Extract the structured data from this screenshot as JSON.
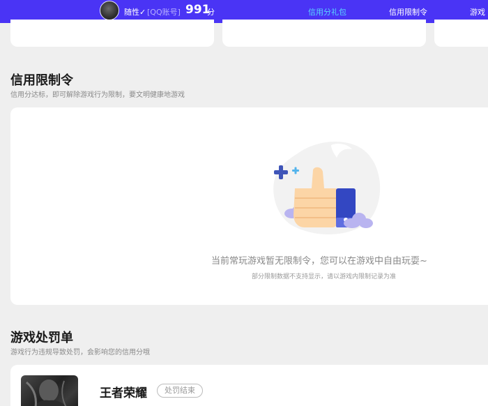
{
  "header": {
    "nickname": "随性✓",
    "account_type": "[QQ账号]",
    "score_value": "991",
    "score_unit": "分",
    "tabs": [
      {
        "label": "信用分礼包",
        "active": true
      },
      {
        "label": "信用限制令",
        "active": false
      },
      {
        "label": "游戏",
        "active": false
      }
    ]
  },
  "restriction": {
    "title": "信用限制令",
    "subtitle": "信用分达标，即可解除游戏行为限制，要文明健康地游戏",
    "empty_message": "当前常玩游戏暂无限制令，您可以在游戏中自由玩耍~",
    "empty_note": "部分限制数据不支持显示，请以游戏内限制记录为准"
  },
  "penalty": {
    "title": "游戏处罚单",
    "subtitle": "游戏行为违规导致处罚，会影响您的信用分哦",
    "items": [
      {
        "game_name": "王者荣耀",
        "status": "处罚结束"
      }
    ]
  },
  "colors": {
    "topbar": "#4a34f5",
    "active_tab": "#5ad5ff",
    "page_bg": "#efefef"
  }
}
